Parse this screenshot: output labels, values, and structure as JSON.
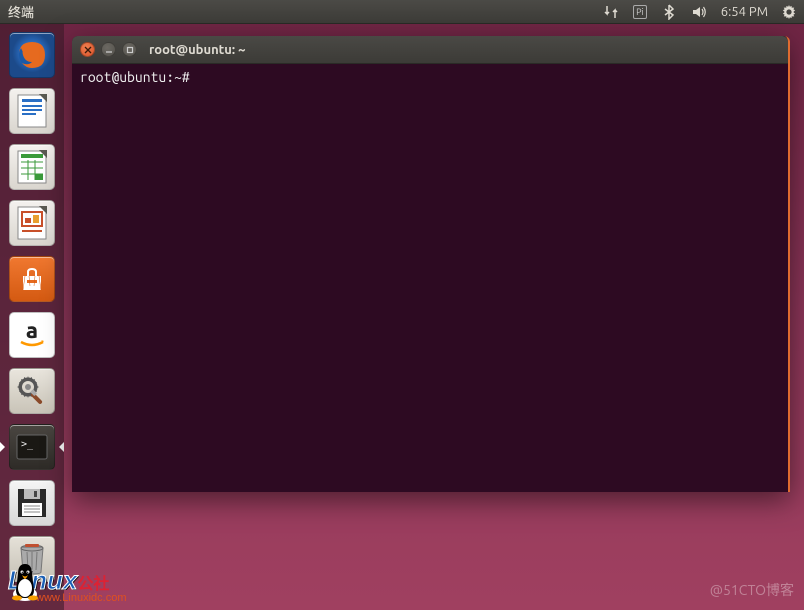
{
  "menubar": {
    "title": "终端",
    "pi_label": "Pi",
    "clock": "6:54 PM"
  },
  "launcher": {
    "items": [
      {
        "name": "firefox",
        "label": "Firefox"
      },
      {
        "name": "writer",
        "label": "LibreOffice Writer"
      },
      {
        "name": "calc",
        "label": "LibreOffice Calc"
      },
      {
        "name": "impress",
        "label": "LibreOffice Impress"
      },
      {
        "name": "software",
        "label": "Ubuntu Software"
      },
      {
        "name": "amazon",
        "label": "Amazon"
      },
      {
        "name": "settings",
        "label": "System Settings"
      },
      {
        "name": "terminal",
        "label": "Terminal"
      },
      {
        "name": "floppy",
        "label": "Floppy Disk"
      },
      {
        "name": "trash",
        "label": "Trash"
      }
    ]
  },
  "terminal": {
    "title": "root@ubuntu: ~",
    "prompt": "root@ubuntu:~#"
  },
  "watermark": {
    "right": "@51CTO博客",
    "left_logo": "Linux",
    "left_cn": "公社",
    "left_url": "www.Linuxidc.com"
  }
}
